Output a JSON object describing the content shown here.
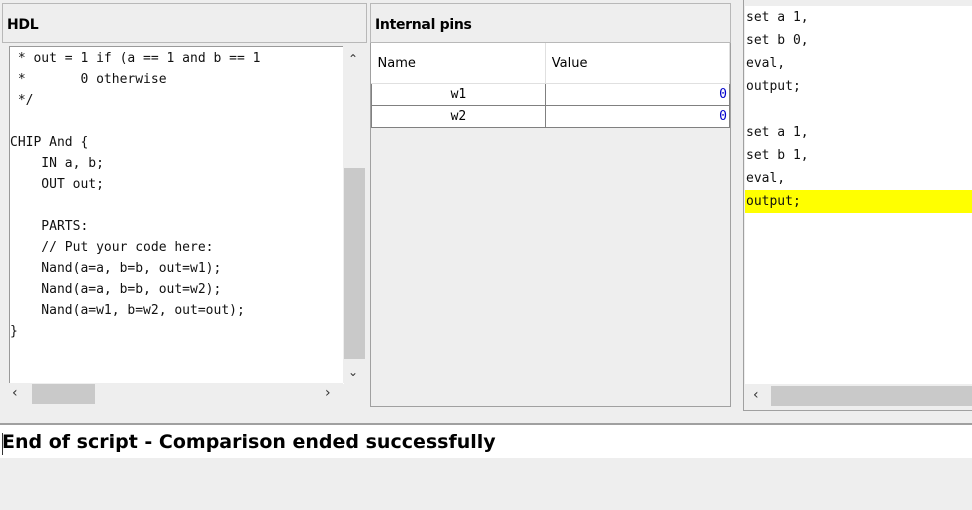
{
  "hdl": {
    "title": "HDL",
    "lines": [
      " * out = 1 if (a == 1 and b == 1",
      " *       0 otherwise",
      " */",
      "",
      "CHIP And {",
      "    IN a, b;",
      "    OUT out;",
      "",
      "    PARTS:",
      "    // Put your code here:",
      "    Nand(a=a, b=b, out=w1);",
      "    Nand(a=a, b=b, out=w2);",
      "    Nand(a=w1, b=w2, out=out);",
      "}"
    ]
  },
  "pins": {
    "title": "Internal pins",
    "columns": [
      "Name",
      "Value"
    ],
    "rows": [
      {
        "name": "w1",
        "value": "0"
      },
      {
        "name": "w2",
        "value": "0"
      }
    ]
  },
  "script": {
    "lines": [
      "set a 1,",
      "set b 0,",
      "eval,",
      "output;",
      "",
      "set a 1,",
      "set b 1,",
      "eval,",
      "output;"
    ],
    "highlight_index": 8,
    "highlight_color": "#ffff00"
  },
  "status": {
    "message": "End of script - Comparison ended successfully"
  },
  "colors": {
    "value_text": "#0000cc"
  }
}
